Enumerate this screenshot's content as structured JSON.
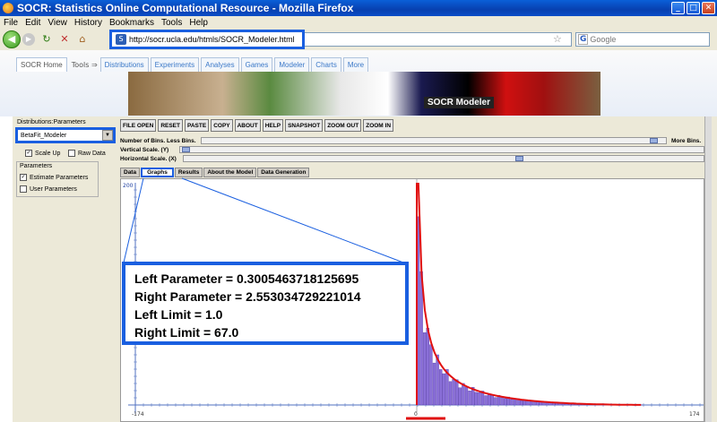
{
  "window": {
    "title": "SOCR: Statistics Online Computational Resource - Mozilla Firefox",
    "min": "_",
    "max": "□",
    "close": "✕"
  },
  "menu": [
    "File",
    "Edit",
    "View",
    "History",
    "Bookmarks",
    "Tools",
    "Help"
  ],
  "nav": {
    "url": "http://socr.ucla.edu/htmls/SOCR_Modeler.html",
    "search_placeholder": "Google"
  },
  "site": {
    "tabs": [
      "SOCR Home",
      "Tools ⇒",
      "Distributions",
      "Experiments",
      "Analyses",
      "Games",
      "Modeler",
      "Charts",
      "More"
    ],
    "banner_title": "SOCR Modeler"
  },
  "sidebar": {
    "title": "Distributions:Parameters",
    "selected_model": "BetaFit_Modeler",
    "scale_up": "Scale Up",
    "raw_data": "Raw Data",
    "parameters_title": "Parameters",
    "estimate_params": "Estimate Parameters",
    "user_params": "User Parameters"
  },
  "toolbar": [
    "FILE OPEN",
    "RESET",
    "PASTE",
    "COPY",
    "ABOUT",
    "HELP",
    "SNAPSHOT",
    "ZOOM OUT",
    "ZOOM IN"
  ],
  "sliders": {
    "bins_label": "Number of Bins. Less Bins.",
    "bins_more": "More Bins.",
    "vscale_label": "Vertical Scale. (Y)",
    "hscale_label": "Horizontal Scale. (X)"
  },
  "subtabs": [
    "Data",
    "Graphs",
    "Results",
    "About the Model",
    "Data Generation"
  ],
  "graph": {
    "y_top_label": "200",
    "x_left": "-174",
    "x_mid": "0",
    "x_right": "174"
  },
  "results": {
    "left_param": "Left Parameter = 0.3005463718125695",
    "right_param": "Right Parameter = 2.553034729221014",
    "left_limit": "Left Limit = 1.0",
    "right_limit": "Right Limit = 67.0"
  },
  "colors": {
    "highlight": "#1a5fe0",
    "histogram": "#8a6fd8",
    "fit_curve": "#e01010"
  }
}
